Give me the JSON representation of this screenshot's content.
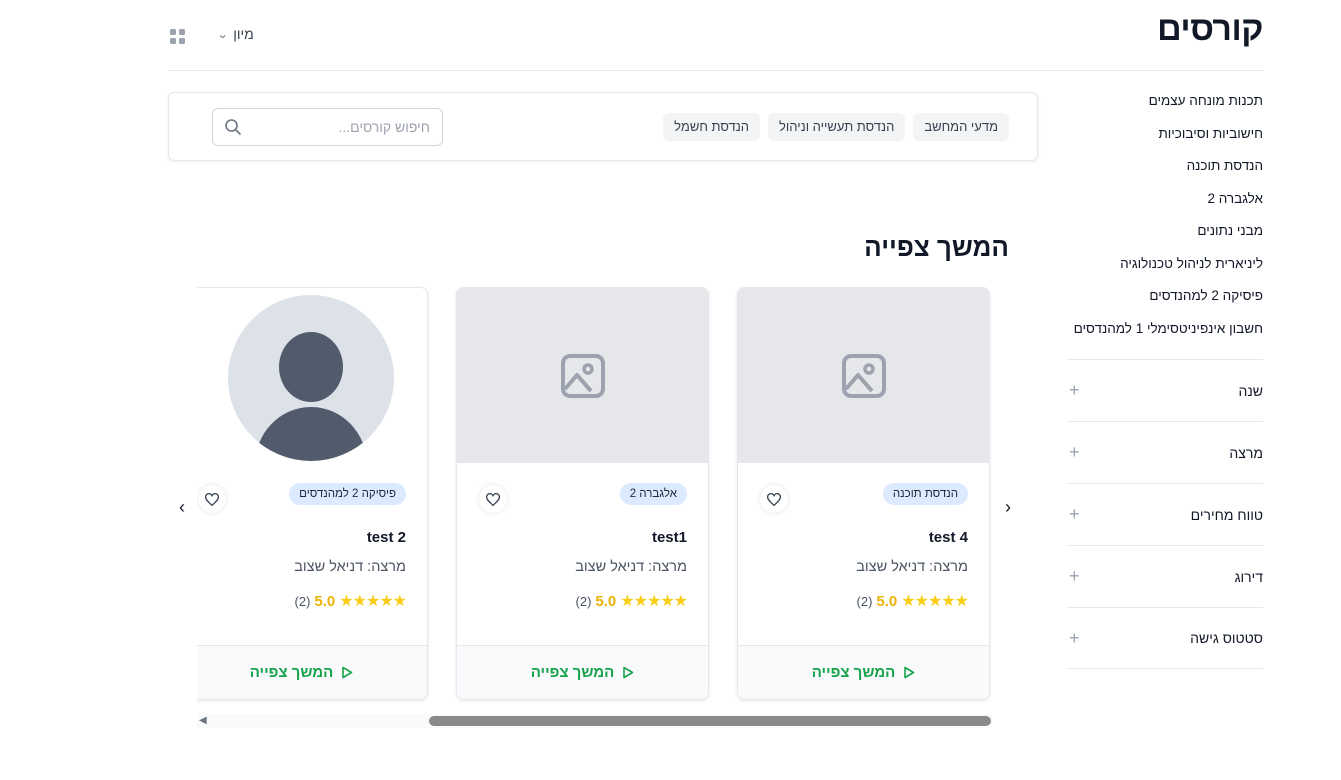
{
  "header": {
    "title": "קורסים",
    "sort_label": "מיון"
  },
  "sidebar": {
    "courses": [
      "תכנות מונחה עצמים",
      "חישוביות וסיבוכיות",
      "הנדסת תוכנה",
      "אלגברה 2",
      "מבני נתונים",
      "ליניארית לניהול טכנולוגיה",
      "פיסיקה 2 למהנדסים",
      "חשבון אינפיניטסימלי 1 למהנדסים"
    ],
    "filters": [
      "שנה",
      "מרצה",
      "טווח מחירים",
      "דירוג",
      "סטטוס גישה"
    ]
  },
  "search": {
    "chips": [
      "מדעי המחשב",
      "הנדסת תעשייה וניהול",
      "הנדסת חשמל"
    ],
    "placeholder": "חיפוש קורסים..."
  },
  "continue_section": {
    "title": "המשך צפייה",
    "cards": [
      {
        "badge": "הנדסת תוכנה",
        "title": "test 4",
        "lecturer": "מרצה: דניאל שצוב",
        "rating": "5.0",
        "rating_count": "(2)",
        "cta": "המשך צפייה",
        "image": "placeholder-image-icon"
      },
      {
        "badge": "אלגברה 2",
        "title": "test1",
        "lecturer": "מרצה: דניאל שצוב",
        "rating": "5.0",
        "rating_count": "(2)",
        "cta": "המשך צפייה",
        "image": "placeholder-image-icon"
      },
      {
        "badge": "פיסיקה 2 למהנדסים",
        "title": "test 2",
        "lecturer": "מרצה: דניאל שצוב",
        "rating": "5.0",
        "rating_count": "(2)",
        "cta": "המשך צפייה",
        "image": "avatar-placeholder-icon"
      }
    ]
  },
  "colors": {
    "accent_green": "#16a34a",
    "star_yellow": "#facc15",
    "badge_blue": "#dbeafe"
  }
}
